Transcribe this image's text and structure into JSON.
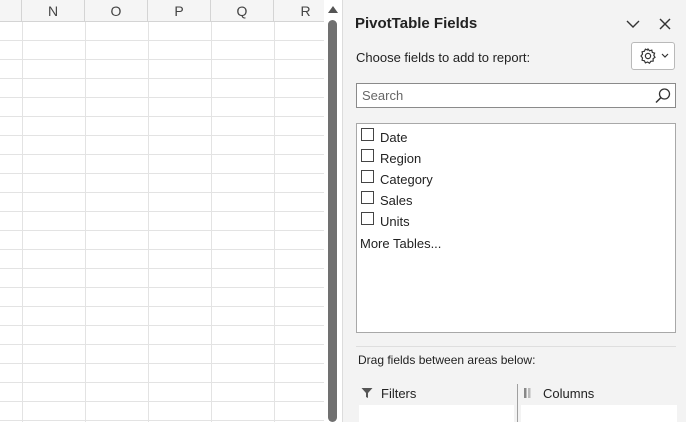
{
  "spreadsheet": {
    "columns": [
      "N",
      "O",
      "P",
      "Q",
      "R"
    ]
  },
  "pane": {
    "title": "PivotTable Fields",
    "choose_label": "Choose fields to add to report:",
    "search": {
      "placeholder": "Search",
      "value": ""
    },
    "fields": [
      {
        "label": "Date",
        "checked": false
      },
      {
        "label": "Region",
        "checked": false
      },
      {
        "label": "Category",
        "checked": false
      },
      {
        "label": "Sales",
        "checked": false
      },
      {
        "label": "Units",
        "checked": false
      }
    ],
    "more_tables": "More Tables...",
    "drag_label": "Drag fields between areas below:",
    "areas": {
      "filters": "Filters",
      "columns": "Columns"
    },
    "icons": {
      "collapse": "chevron-down-icon",
      "close": "close-icon",
      "settings": "gear-icon",
      "search": "search-icon",
      "filters": "filter-icon",
      "columns": "columns-icon"
    }
  },
  "colors": {
    "pane_bg": "#f3f3f3",
    "grid_line": "#e3e3e3",
    "scroll_thumb": "#707070"
  }
}
